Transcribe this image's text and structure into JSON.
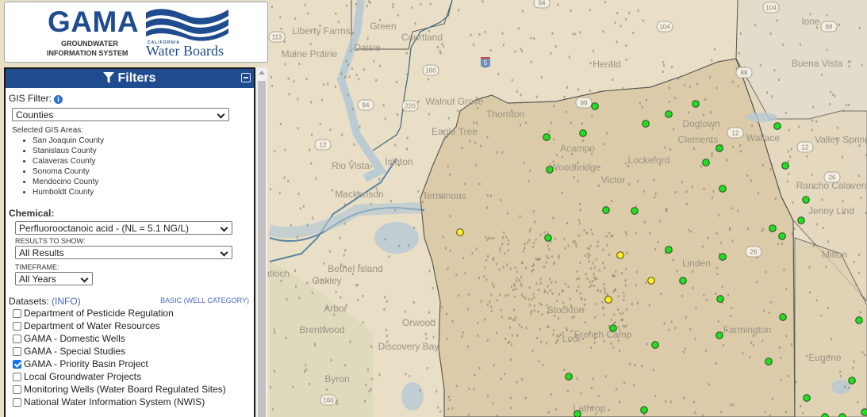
{
  "logo": {
    "title": "GAMA",
    "subtitle_line1": "GROUNDWATER",
    "subtitle_line2": "INFORMATION SYSTEM",
    "org_small": "CALIFORNIA",
    "org_name": "Water Boards",
    "brand_color": "#1f4c8f"
  },
  "filters": {
    "header": "Filters",
    "header_icon": "filter-icon",
    "collapse_icon": "minus-square-icon",
    "gis_filter_label": "GIS Filter:",
    "gis_filter_value": "Counties",
    "selected_areas_label": "Selected GIS Areas:",
    "selected_areas": [
      "San Joaquin County",
      "Stanislaus County",
      "Calaveras County",
      "Sonoma County",
      "Mendocino County",
      "Humboldt County"
    ],
    "chemical_label": "Chemical:",
    "chemical_value": "Perfluorooctanoic acid - (NL = 5.1 NG/L)",
    "results_label": "RESULTS TO SHOW:",
    "results_value": "All Results",
    "timeframe_label": "TIMEFRAME:",
    "timeframe_value": "All Years",
    "datasets_label": "Datasets:",
    "datasets_info_link": "(INFO)",
    "basic_link": "BASIC (WELL CATEGORY)",
    "datasets": [
      {
        "label": "Department of Pesticide Regulation",
        "checked": false
      },
      {
        "label": "Department of Water Resources",
        "checked": false
      },
      {
        "label": "GAMA - Domestic Wells",
        "checked": false
      },
      {
        "label": "GAMA - Special Studies",
        "checked": false
      },
      {
        "label": "GAMA - Priority Basin Project",
        "checked": true
      },
      {
        "label": "Local Groundwater Projects",
        "checked": false
      },
      {
        "label": "Monitoring Wells (Water Board Regulated Sites)",
        "checked": false
      },
      {
        "label": "National Water Information System (NWIS)",
        "checked": false
      }
    ]
  },
  "map": {
    "place_labels": [
      "Liberty Farms",
      "Green",
      "Courtland",
      "Maine Prairie",
      "Daisie",
      "Herald",
      "Ione",
      "Buena Vista",
      "Walnut Grove",
      "Thornton",
      "Dogtown",
      "Clements",
      "Wallace",
      "Valley Springs",
      "Eagle Tree",
      "Rio Vista",
      "Isleton",
      "Acampo",
      "Woodbridge",
      "Lockeford",
      "Victor",
      "Rancho Calaveras",
      "Jenny Lind",
      "Terminous",
      "Mackenson",
      "Bethel Island",
      "Oakley",
      "Antioch",
      "Arbor",
      "Lodi",
      "Brentwood",
      "Orwood",
      "Discovery Bay",
      "Byron",
      "Milton",
      "Farmington",
      "Eugene",
      "Lathrop",
      "Linden",
      "French Camp",
      "Stockton"
    ],
    "route_shields": [
      "113",
      "94",
      "104",
      "104",
      "88",
      "88",
      "5",
      "160",
      "220",
      "84",
      "12",
      "12",
      "12",
      "26",
      "26",
      "99",
      "160"
    ],
    "legend_colors": {
      "below_threshold": "#22dd22",
      "detected": "#ffee22"
    },
    "wells_green_count": 37,
    "wells_yellow_count": 4
  }
}
